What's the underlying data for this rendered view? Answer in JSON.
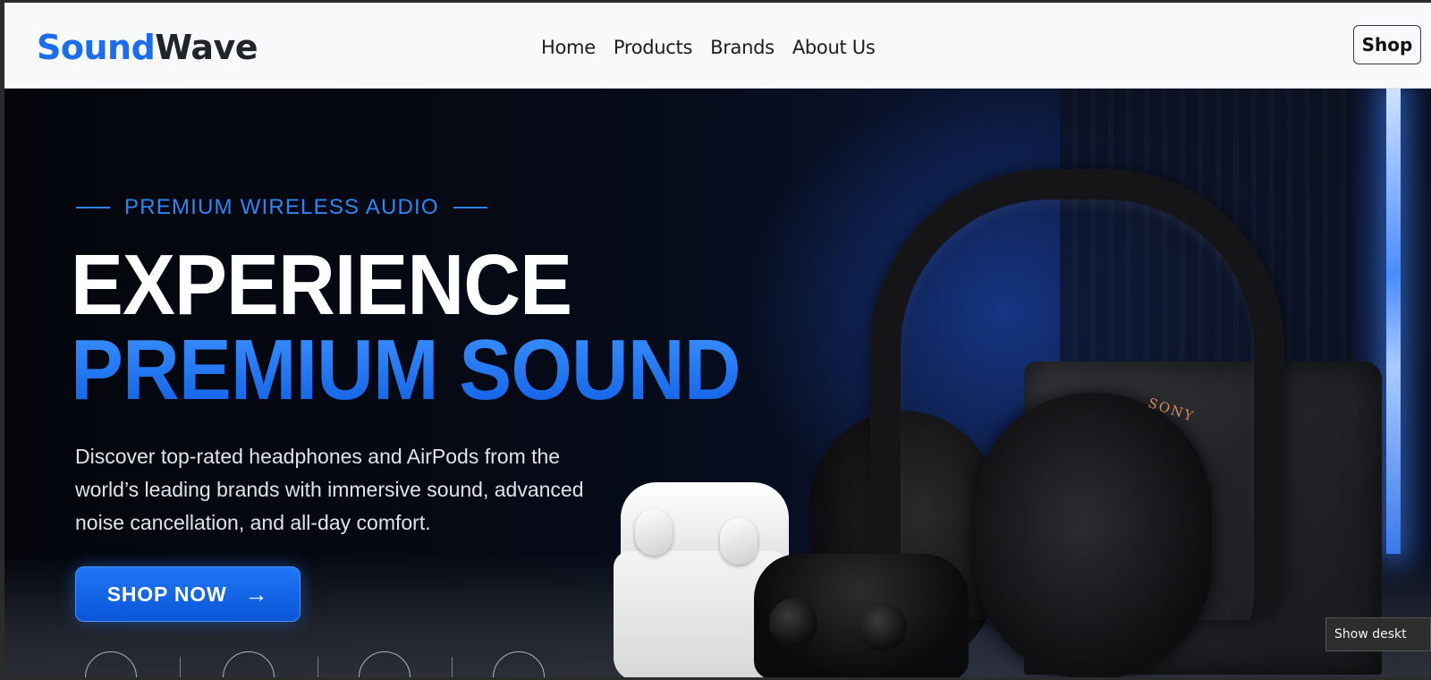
{
  "navbar": {
    "brand_part1": "Sound",
    "brand_part2": "Wave",
    "links": [
      "Home",
      "Products",
      "Brands",
      "About Us"
    ],
    "shop_label": "Shop"
  },
  "hero": {
    "eyebrow": "PREMIUM WIRELESS AUDIO",
    "headline_line1": "EXPERIENCE",
    "headline_line2": "PREMIUM SOUND",
    "description": "Discover top-rated headphones and AirPods from the world’s leading brands with immersive sound, advanced noise cancellation, and all-day comfort.",
    "cta_label": "SHOP NOW",
    "cta_icon": "arrow-right-icon",
    "headphone_brand": "SONY"
  },
  "tooltip": {
    "text": "Show deskt"
  },
  "colors": {
    "accent": "#1a6cf0",
    "navbar_bg": "#f8f9fa",
    "hero_bg": "#05070d"
  }
}
